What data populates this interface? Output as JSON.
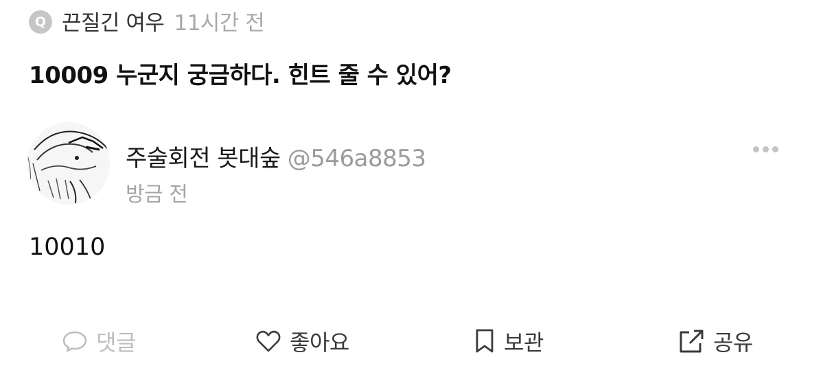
{
  "question": {
    "badge": "Q",
    "author": "끈질긴 여우",
    "time": "11시간 전",
    "text": "10009 누군지 궁금하다. 힌트 줄 수 있어?"
  },
  "answer": {
    "avatar_icon": "manga-character-avatar-icon",
    "author": "주술회전 봇대숲",
    "handle": "@546a8853",
    "time": "방금 전",
    "more_icon": "more-dots-icon",
    "text": "10010"
  },
  "actions": {
    "comment": {
      "label": "댓글",
      "icon": "speech-bubble-icon",
      "color": "#bdbdbd"
    },
    "like": {
      "label": "좋아요",
      "icon": "heart-icon"
    },
    "save": {
      "label": "보관",
      "icon": "bookmark-icon"
    },
    "share": {
      "label": "공유",
      "icon": "share-icon"
    }
  },
  "colors": {
    "text_primary": "#111111",
    "text_muted": "#a8a8a8",
    "badge_bg": "#c6c6c6"
  }
}
